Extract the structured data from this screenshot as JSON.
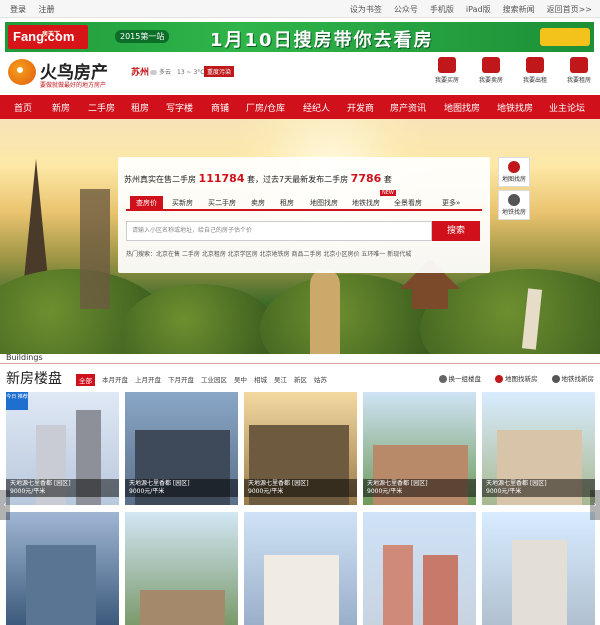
{
  "topbar": {
    "left": [
      "登录",
      "注册"
    ],
    "right": [
      "设为书签",
      "公众号",
      "手机版",
      "iPad版",
      "搜索新闻",
      "返回首页>>"
    ]
  },
  "ad": {
    "brand_small": "房天下",
    "brand": "Fang.com",
    "year_tag": "2015第一站",
    "headline": "1月10日搜房带你去看房"
  },
  "header": {
    "site_name": "火鸟房产",
    "slogan": "要做就做最好的地方房产",
    "city": "苏州",
    "weather": "多云　13 ~ 3°C",
    "pollution": "重度污染",
    "quick_links": [
      "我要买房",
      "我要卖房",
      "我要出租",
      "我要租房"
    ]
  },
  "nav": [
    "首页",
    "新房",
    "二手房",
    "租房",
    "写字楼",
    "商铺",
    "厂房/仓库",
    "经纪人",
    "开发商",
    "房产资讯",
    "地图找房",
    "地铁找房",
    "业主论坛"
  ],
  "search": {
    "head_prefix": "苏州真实在售二手房",
    "count_sale": "111784",
    "head_mid": "套，过去7天最新发布二手房",
    "count_new": "7786",
    "head_suffix": "套",
    "tabs": [
      "查房价",
      "买新房",
      "买二手房",
      "卖房",
      "租房",
      "地图找房",
      "地铁找房",
      "全景看房",
      "更多»"
    ],
    "new_tag": "NEW",
    "placeholder": "请输入小区名称或地址，给自己的房子估个价",
    "button": "搜索",
    "hot": "热门搜索：北京在售 二手房 北京租房 北京学区房 北京地铁房 商品二手房 北京小区房价 五环唯一 新现代城"
  },
  "side_buttons": [
    "地图找房",
    "地铁找房"
  ],
  "section": {
    "en": "Buildings",
    "title": "新房楼盘",
    "filters": [
      "全部",
      "本月开盘",
      "上月开盘",
      "下月开盘",
      "工业园区",
      "吴中",
      "相城",
      "吴江",
      "新区",
      "姑苏"
    ],
    "right_links": [
      "换一组楼盘",
      "地图找新房",
      "地铁找新房"
    ]
  },
  "cards": [
    {
      "name": "天地源七里香都 [园区]",
      "price": "9000元/平米",
      "badge": "今日\n推荐"
    },
    {
      "name": "天地源七里香都 [园区]",
      "price": "9000元/平米"
    },
    {
      "name": "天地源七里香都 [园区]",
      "price": "9000元/平米"
    },
    {
      "name": "天地源七里香都 [园区]",
      "price": "9000元/平米"
    },
    {
      "name": "天地源七里香都 [园区]",
      "price": "9000元/平米"
    }
  ],
  "colors": {
    "brand": "#d0101b",
    "ad_green": "#2fb54a",
    "badge_blue": "#1f6fd1"
  }
}
